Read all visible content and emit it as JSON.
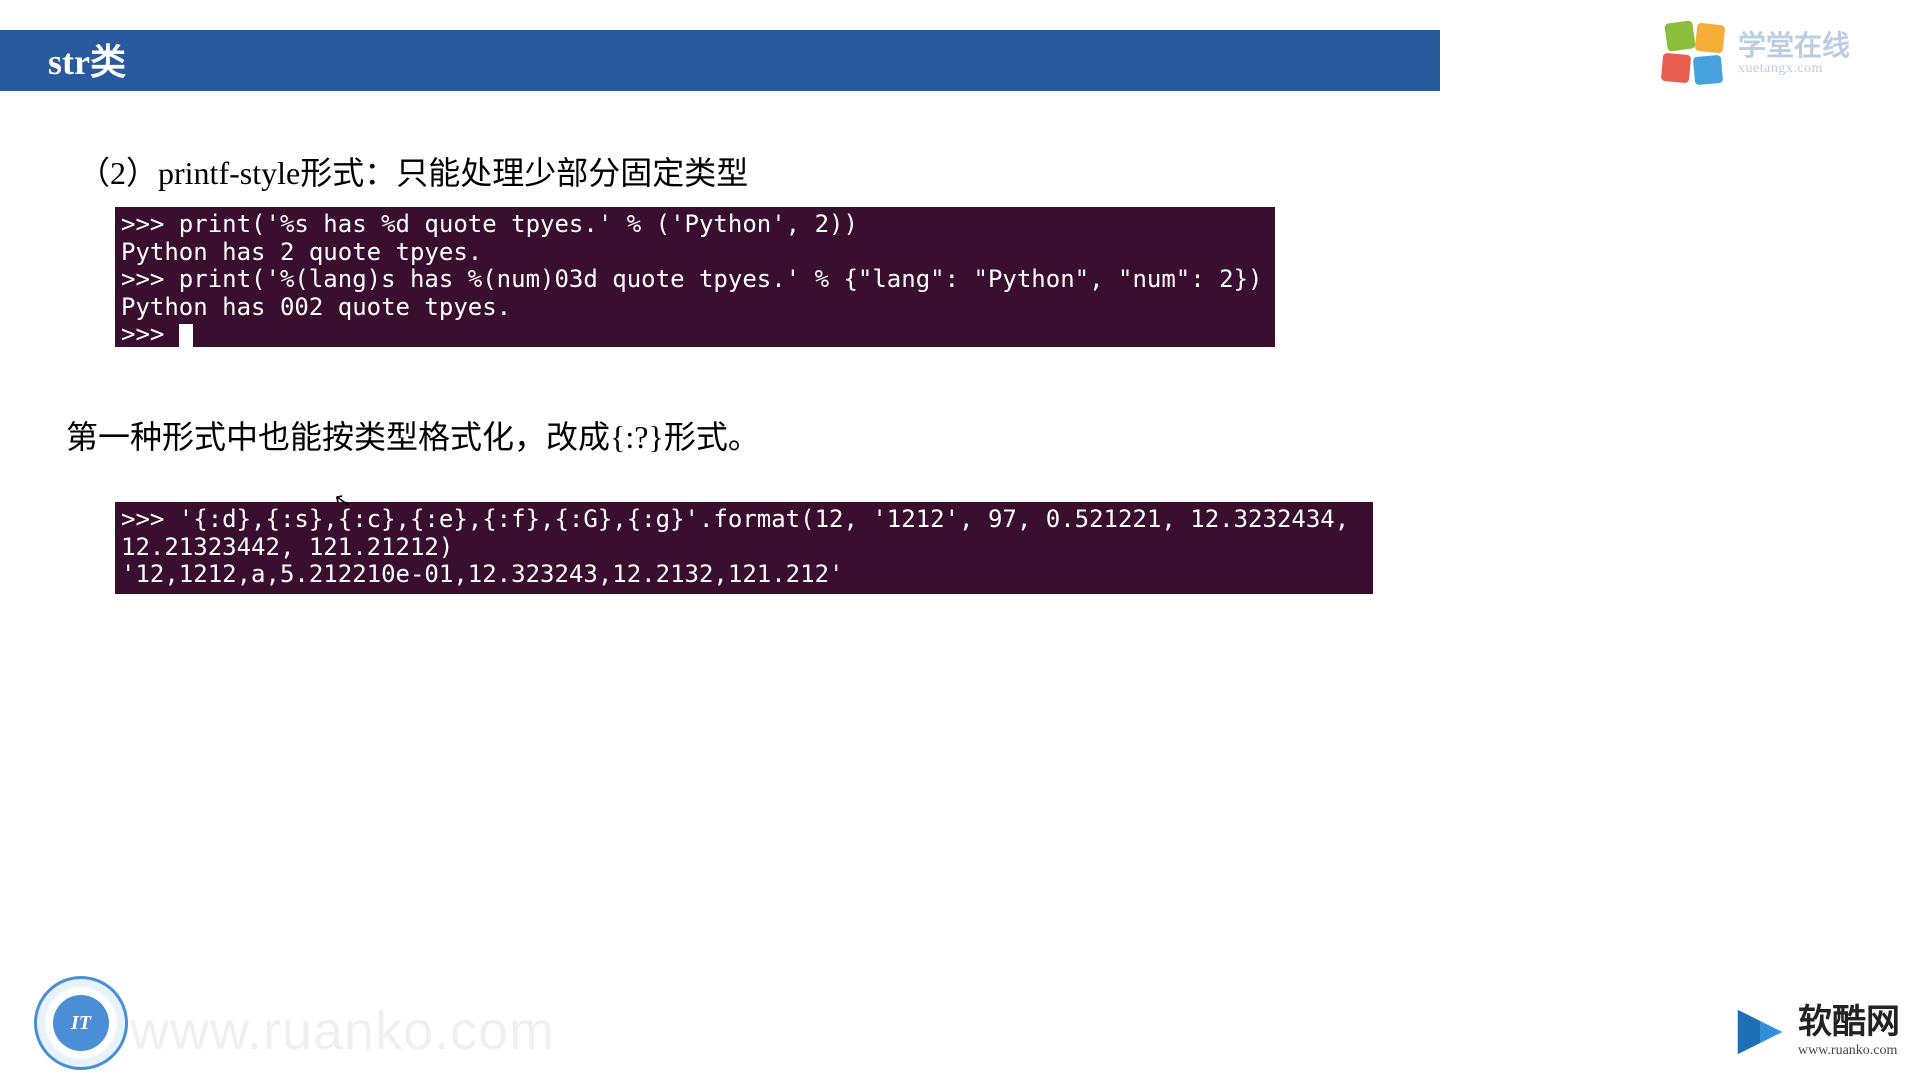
{
  "header": {
    "title": "str类"
  },
  "logo_top_right": {
    "cn": "学堂在线",
    "en": "xuetangx.com"
  },
  "section": {
    "heading": "（2）printf-style形式：只能处理少部分固定类型",
    "note": "第一种形式中也能按类型格式化，改成{:?}形式。"
  },
  "terminal1": {
    "lines": [
      ">>> print('%s has %d quote tpyes.' % ('Python', 2))",
      "Python has 2 quote tpyes.",
      ">>> print('%(lang)s has %(num)03d quote tpyes.' % {\"lang\": \"Python\", \"num\": 2})",
      "Python has 002 quote tpyes.",
      ">>> "
    ]
  },
  "terminal2": {
    "lines": [
      ">>> '{:d},{:s},{:c},{:e},{:f},{:G},{:g}'.format(12, '1212', 97, 0.521221, 12.3232434, 12.21323442, 121.21212)",
      "'12,1212,a,5.212210e-01,12.323243,12.2132,121.212'"
    ]
  },
  "badge_bl": {
    "text": "IT"
  },
  "watermark": {
    "text": "www.ruanko.com"
  },
  "logo_br": {
    "cn": "软酷网",
    "en": "www.ruanko.com"
  }
}
